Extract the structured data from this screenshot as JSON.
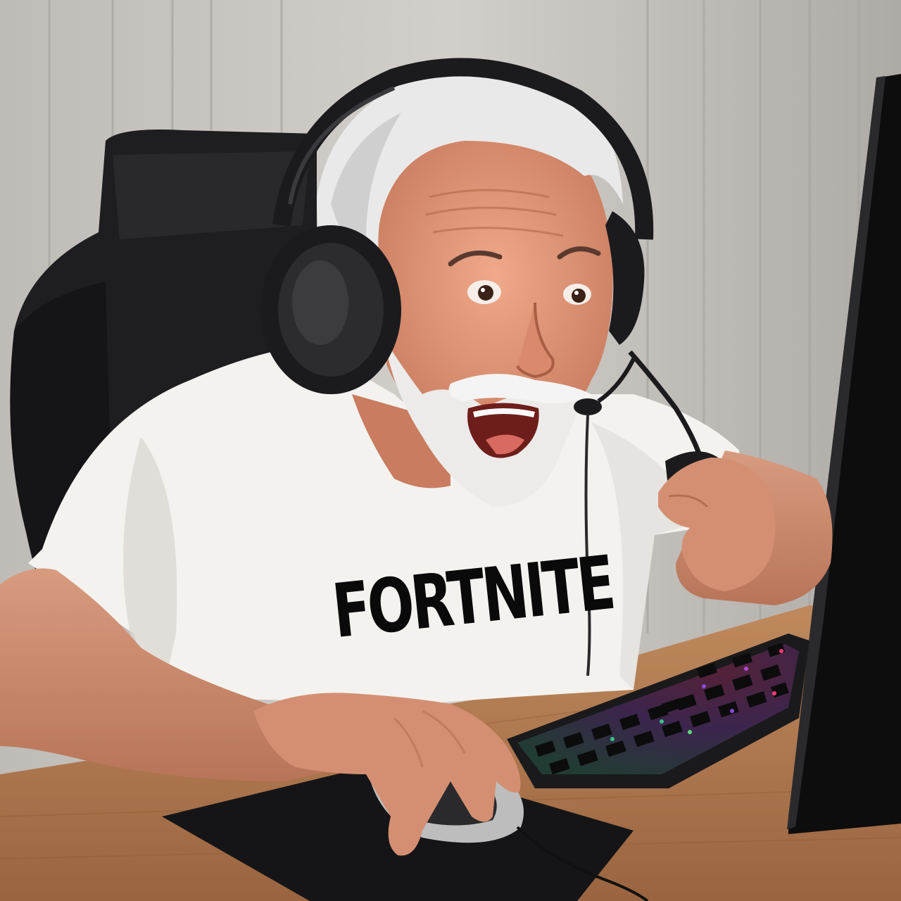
{
  "shirt": {
    "text": "FORTNITE"
  },
  "colors": {
    "wall": "#c9c6c2",
    "chair": "#1e1e20",
    "shirt": "#f3f2ef",
    "skin": "#d99377",
    "hair": "#e9e9e9",
    "desk": "#b07a52",
    "keyboard": "#1a1a1c",
    "monitor": "#0d0d0e",
    "headset": "#1b1b1d",
    "mousepad": "#151517"
  },
  "icons": [
    "headset-icon",
    "microphone-icon",
    "mouse-icon",
    "keyboard-icon",
    "monitor-icon"
  ]
}
